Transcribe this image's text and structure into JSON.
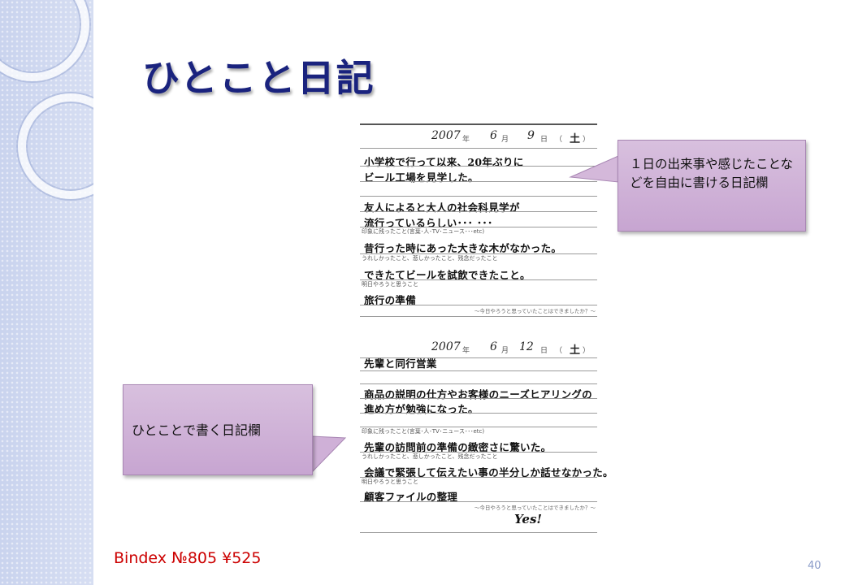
{
  "slide": {
    "title": "ひとこと日記",
    "page_number": "40",
    "product_note": "Bindex №805 ¥525"
  },
  "callouts": {
    "diary_column": "１日の出来事や感じたことなどを自由に書ける日記欄",
    "one_line_column": "ひとことで書く日記欄"
  },
  "diary": {
    "labels": {
      "year_unit": "年",
      "month_unit": "月",
      "day_unit": "日",
      "paren_open": "（",
      "paren_close": "）",
      "impression": "印象に残ったこと(言葉･人･TV･ニュース･･･etc)",
      "feelings": "うれしかったこと、悲しかったこと、残念だったこと",
      "tomorrow": "明日やろうと思うこと",
      "review": "～今日やろうと思っていたことはできましたか？～"
    },
    "entries": [
      {
        "year": "2007",
        "month": "6",
        "day": "9",
        "weekday": "土",
        "diary_lines": [
          "小学校で行って以来、20年ぶりに",
          "ビール工場を見学した。",
          "",
          "友人によると大人の社会科見学が",
          "流行っているらしい･･･ ･･･"
        ],
        "impression": "昔行った時にあった大きな木がなかった。",
        "feelings": "できたてビールを試飲できたこと。",
        "tomorrow": "旅行の準備",
        "review": ""
      },
      {
        "year": "2007",
        "month": "6",
        "day": "12",
        "weekday": "土",
        "diary_lines": [
          "先輩と同行営業",
          "",
          "商品の説明の仕方やお客様のニーズヒアリングの",
          "進め方が勉強になった。",
          ""
        ],
        "impression": "先輩の訪問前の準備の緻密さに驚いた。",
        "feelings": "会議で緊張して伝えたい事の半分しか話せなかった。",
        "tomorrow": "顧客ファイルの整理",
        "review": "Yes!"
      }
    ]
  }
}
